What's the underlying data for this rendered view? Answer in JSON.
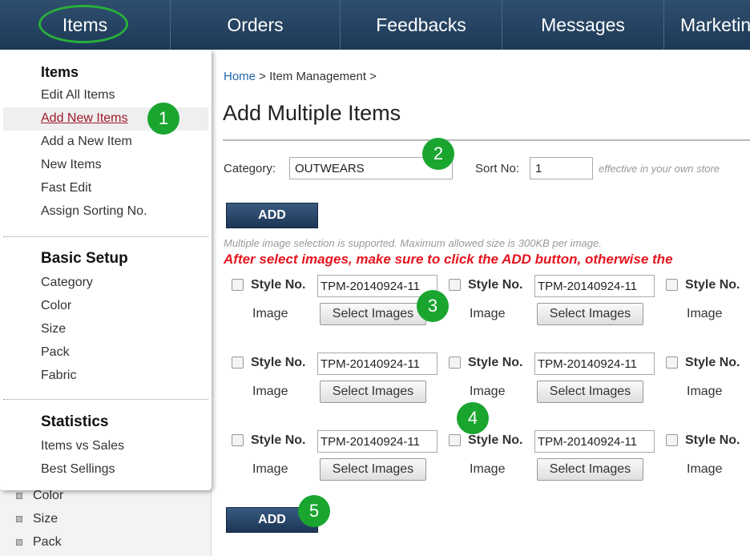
{
  "nav": {
    "tabs": [
      "Items",
      "Orders",
      "Feedbacks",
      "Messages",
      "Marketing"
    ]
  },
  "sidebar": {
    "items": [
      "Color",
      "Size",
      "Pack"
    ]
  },
  "flyout": {
    "sections": [
      {
        "heading": "Items",
        "items": [
          "Edit All Items",
          "Add New Items",
          "Add a New Item",
          "New Items",
          "Fast Edit",
          "Assign Sorting No."
        ]
      },
      {
        "heading": "Basic Setup",
        "items": [
          "Category",
          "Color",
          "Size",
          "Pack",
          "Fabric"
        ]
      },
      {
        "heading": "Statistics",
        "items": [
          "Items vs Sales",
          "Best Sellings"
        ]
      }
    ],
    "active_item": "Add New Items"
  },
  "markers": [
    "1",
    "2",
    "3",
    "4",
    "5"
  ],
  "breadcrumb": {
    "home": "Home",
    "rest": " > Item Management >"
  },
  "page_title": "Add Multiple Items",
  "form": {
    "category_label": "Category:",
    "category_value": "OUTWEARS",
    "sort_label": "Sort No:",
    "sort_value": "1",
    "sort_hint": "effective in your own store"
  },
  "add_label": "ADD",
  "notes": {
    "info": "Multiple image selection is supported. Maximum allowed size is 300KB per image.",
    "warning": "After select images, make sure to click the ADD button, otherwise the"
  },
  "grid": {
    "style_label": "Style No.",
    "image_label": "Image",
    "style_value": "TPM-20140924-11",
    "select_label": "Select Images"
  },
  "colors": {
    "nav_bg": "#1d3957",
    "marker": "#1aa52f",
    "warning": "#e6141e",
    "link": "#2067a8"
  }
}
